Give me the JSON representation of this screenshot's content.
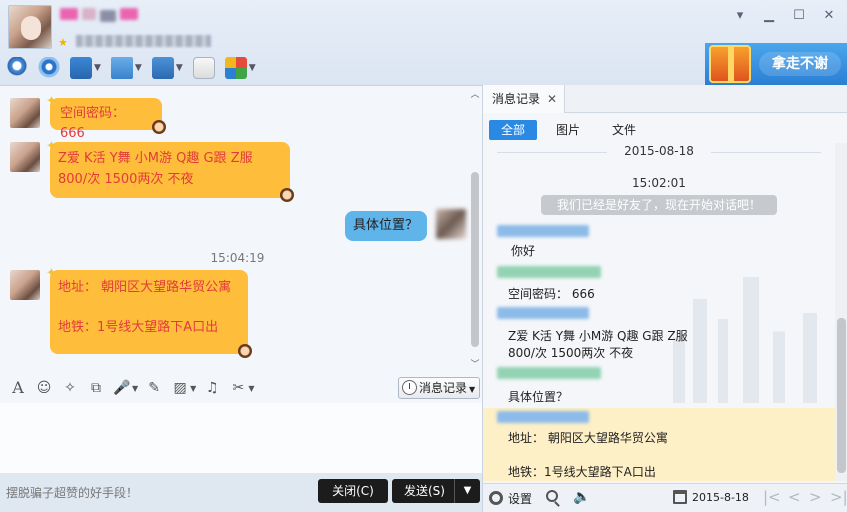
{
  "header": {
    "promo_label": "拿走不谢",
    "controls": {
      "dropdown": "▾",
      "minimize": "▁",
      "maximize": "☐",
      "close": "✕"
    }
  },
  "chat": {
    "messages": [
      {
        "side": "left",
        "lines": [
          "空间密码： 666"
        ]
      },
      {
        "side": "left",
        "lines": [
          "Z爱  K活  Y舞  小M游  Q趣  G跟  Z服",
          "800/次  1500两次     不夜"
        ]
      },
      {
        "side": "right",
        "lines": [
          "具体位置？"
        ]
      },
      {
        "time": "15:04:19"
      },
      {
        "side": "left",
        "lines": [
          "地址：  朝阳区大望路华贸公寓",
          "",
          "地铁：1号线大望路下A口出"
        ]
      }
    ]
  },
  "input": {
    "history_button": "消息记录",
    "tip": "摆脱骗子超赞的好手段！",
    "close_button": "关闭(C)",
    "send_button": "发送(S)",
    "send_split": "▼"
  },
  "history": {
    "tab_label": "消息记录",
    "tab_close": "✕",
    "filters": {
      "all": "全部",
      "images": "图片",
      "files": "文件"
    },
    "date": "2015-08-18",
    "time": "15:02:01",
    "system_message": "我们已经是好友了，现在开始对话吧！",
    "entries": [
      {
        "sender_color": "blue",
        "text": "你好"
      },
      {
        "sender_color": "green",
        "text": "空间密码： 666"
      },
      {
        "sender_color": "blue",
        "text": "Z爱  K活  Y舞  小M游  Q趣  G跟  Z服"
      },
      {
        "sender_color": "blue",
        "text": "800/次  1500两次     不夜"
      },
      {
        "sender_color": "green",
        "text": "具体位置？"
      },
      {
        "sender_color": "blue",
        "text": "地址：  朝阳区大望路华贸公寓"
      },
      {
        "sender_color": "blue",
        "text": "地铁：1号线大望路下A口出"
      }
    ],
    "footer": {
      "settings": "设置",
      "date": "2015-8-18",
      "nav_first": "|<",
      "nav_prev": "<",
      "nav_next": ">",
      "nav_last": ">|"
    }
  },
  "icons": {
    "star": "★",
    "deco": "✦",
    "input_tools": [
      "A",
      "☺",
      "✂",
      "⌘",
      "🎙",
      "✎",
      "▣",
      "♫",
      "✂"
    ]
  },
  "colors": {
    "bubble_yellow": "#ffbd3c",
    "bubble_text_red": "#e23b3b",
    "bubble_blue": "#5fb4ea",
    "accent_blue": "#2a8ae3",
    "button_dark": "#1c1c1c",
    "highlight": "#fdefc6"
  }
}
